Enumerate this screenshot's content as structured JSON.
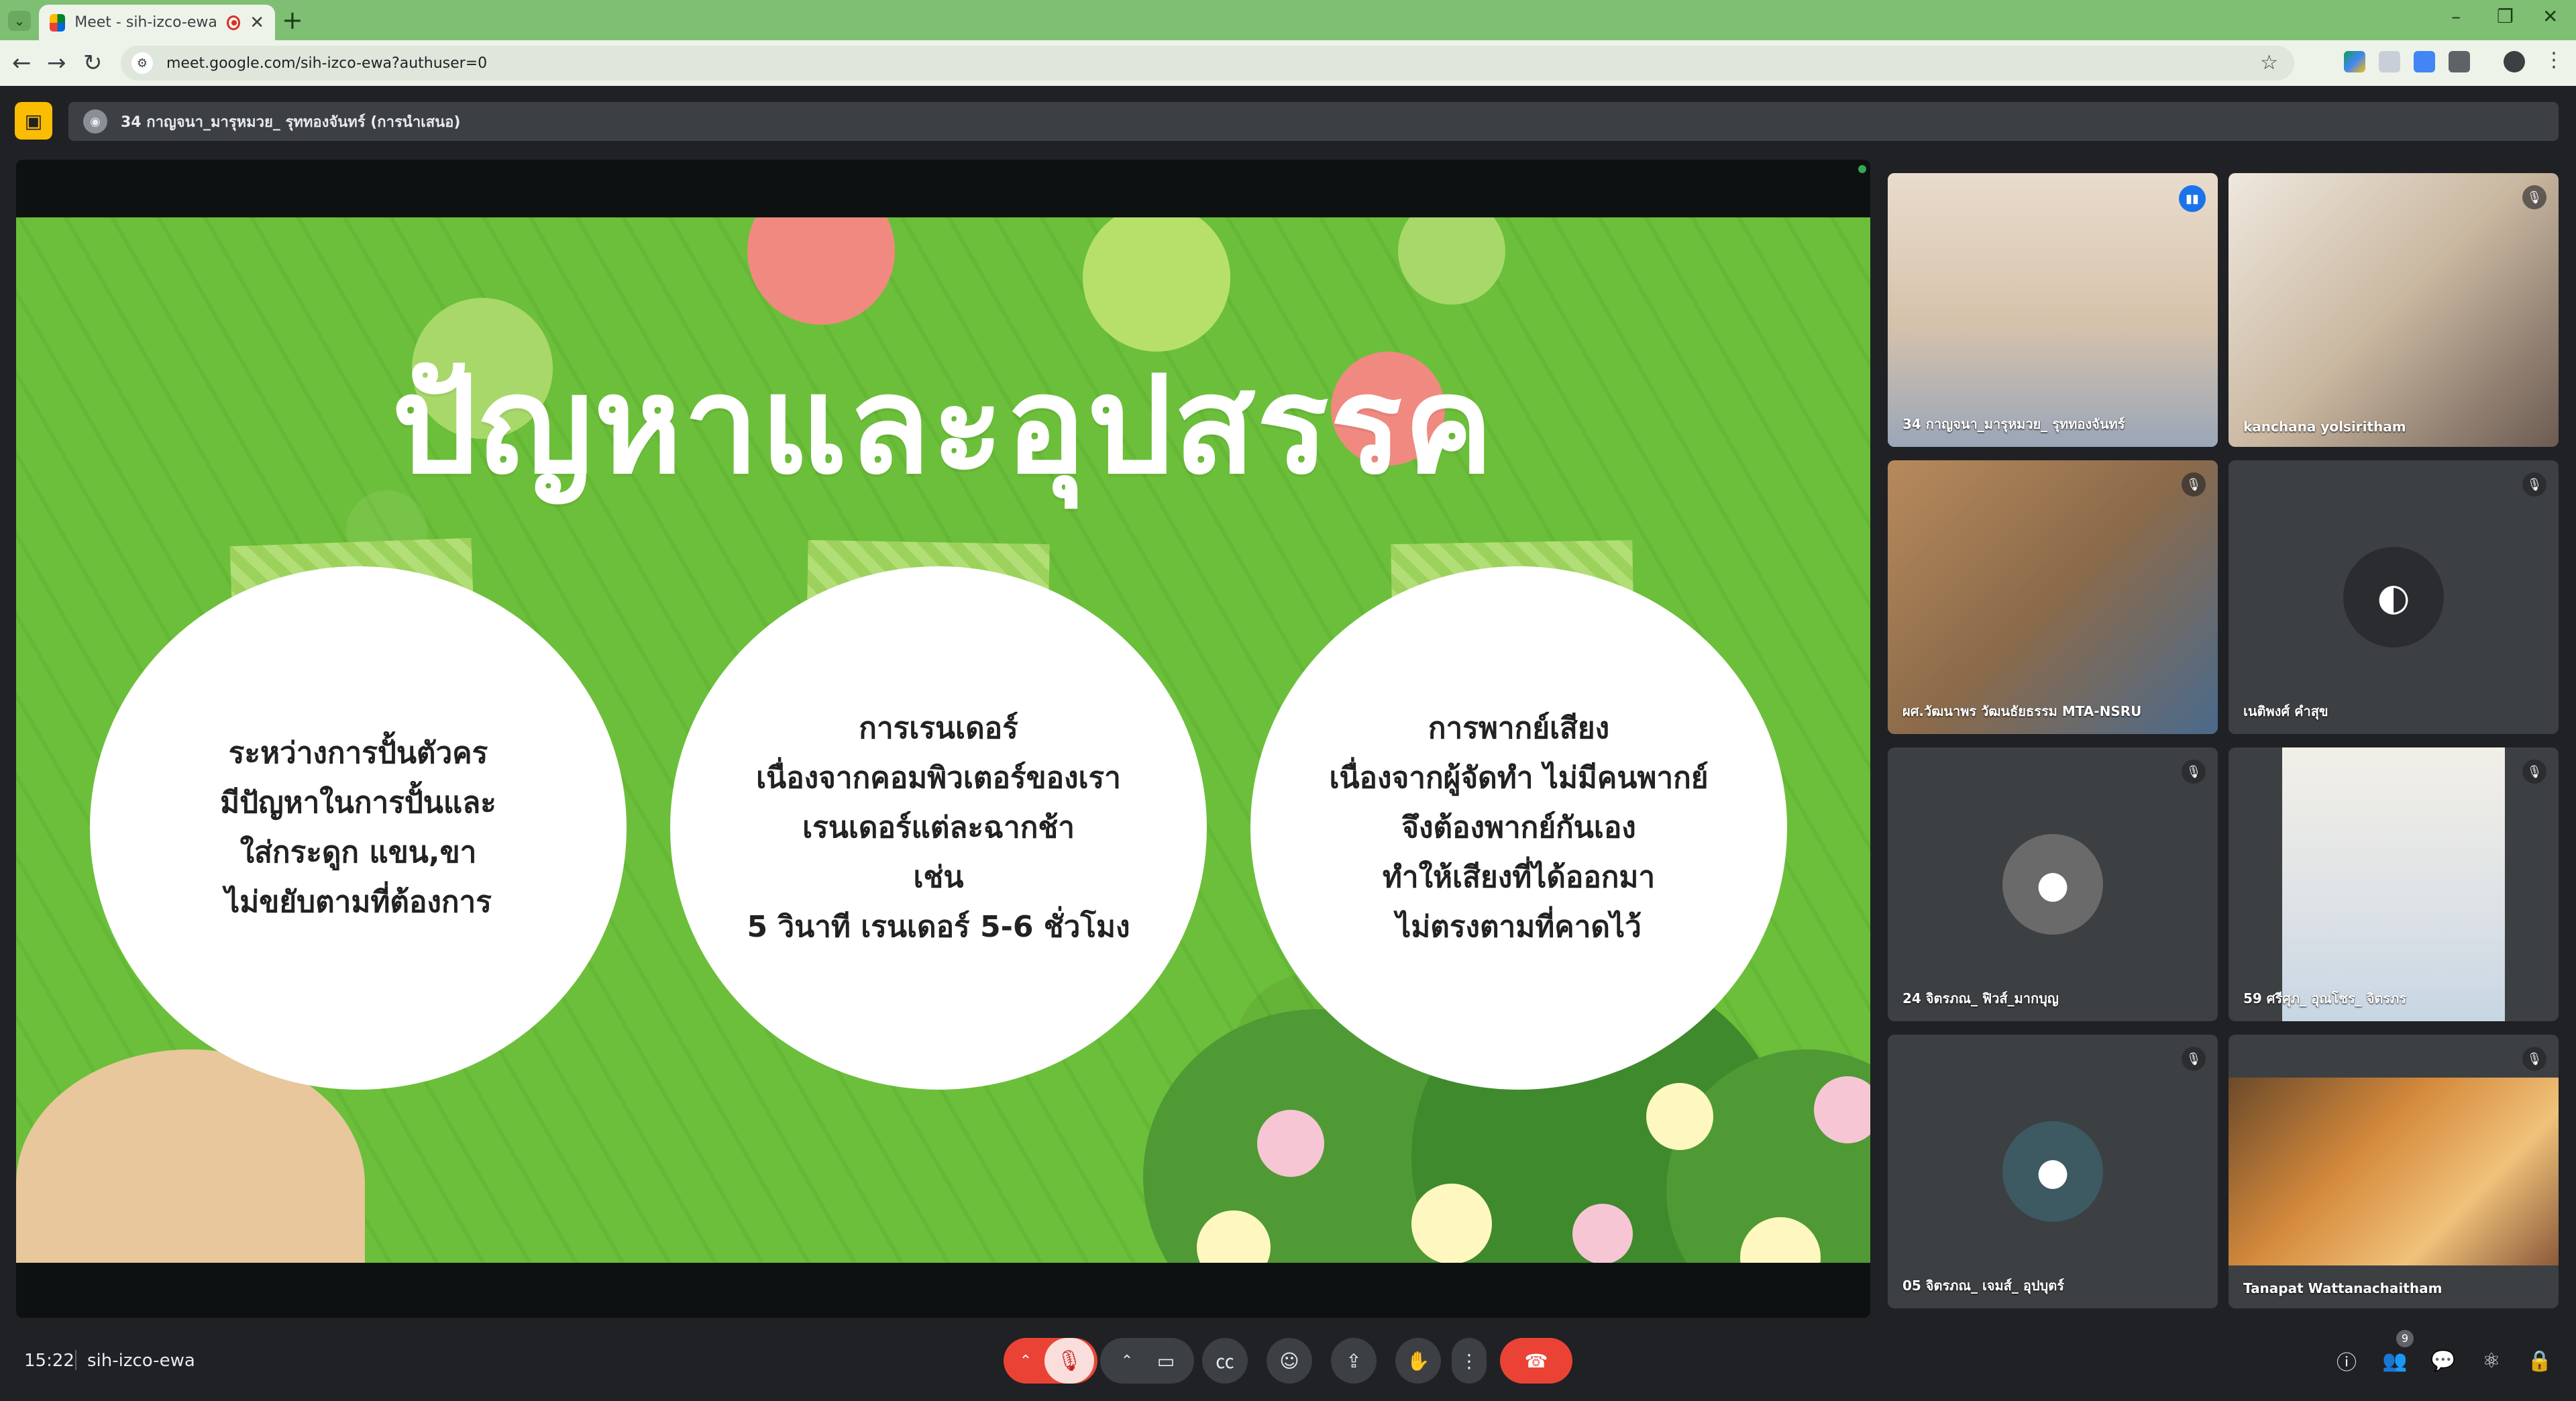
{
  "browser": {
    "tab_title": "Meet - sih-izco-ewa",
    "url": "meet.google.com/sih-izco-ewa?authuser=0"
  },
  "meet": {
    "presenter_label": "34 กาญจนา_มารุหมวย_ รุททองจันทร์ (การนำเสนอ)",
    "time": "15:22",
    "meeting_code": "sih-izco-ewa",
    "participants_count": "9"
  },
  "slide": {
    "title": "ปัญหาและอุปสรรค",
    "bubbles": [
      {
        "lines": [
          "ระหว่างการปั้นตัวคร",
          "มีปัญหาในการปั้นและ",
          "ใส่กระดูก แขน,ขา",
          "ไม่ขยับตามที่ต้องการ"
        ]
      },
      {
        "lines": [
          "การเรนเดอร์",
          "เนื่องจากคอมพิวเตอร์ของเรา",
          "เรนเดอร์แต่ละฉากช้า",
          "เช่น",
          "5 วินาที เรนเดอร์ 5-6 ชั่วโมง"
        ]
      },
      {
        "lines": [
          "การพากย์เสียง",
          "เนื่องจากผู้จัดทำ ไม่มีคนพากย์",
          "จึงต้องพากย์กันเอง",
          "ทำให้เสียงที่ได้ออกมา",
          "ไม่ตรงตามที่คาดไว้"
        ]
      }
    ]
  },
  "participants": [
    {
      "name": "34 กาญจนา_มารุหมวย_ รุททองจันทร์"
    },
    {
      "name": "kanchana yolsiritham"
    },
    {
      "name": "ผศ.วัฒนาพร วัฒนธัยธรรม MTA-NSRU"
    },
    {
      "name": "เนติพงศ์ คำสุข"
    },
    {
      "name": "24 จิตรภณ_ ฟิวส์_มากบุญ"
    },
    {
      "name": "59 ศรีศุภ_ อุณโชร_ จิตรภร"
    },
    {
      "name": "05 จิตรภณ_ เจมส์_ อุปบุตร์"
    },
    {
      "name": "Tanapat Wattanachaitham"
    }
  ],
  "colors": {
    "slide_green": "#6cbf3a",
    "hangup_red": "#ea4335",
    "present_yellow": "#fbbc04",
    "active_outline": "#8ab4f8"
  }
}
